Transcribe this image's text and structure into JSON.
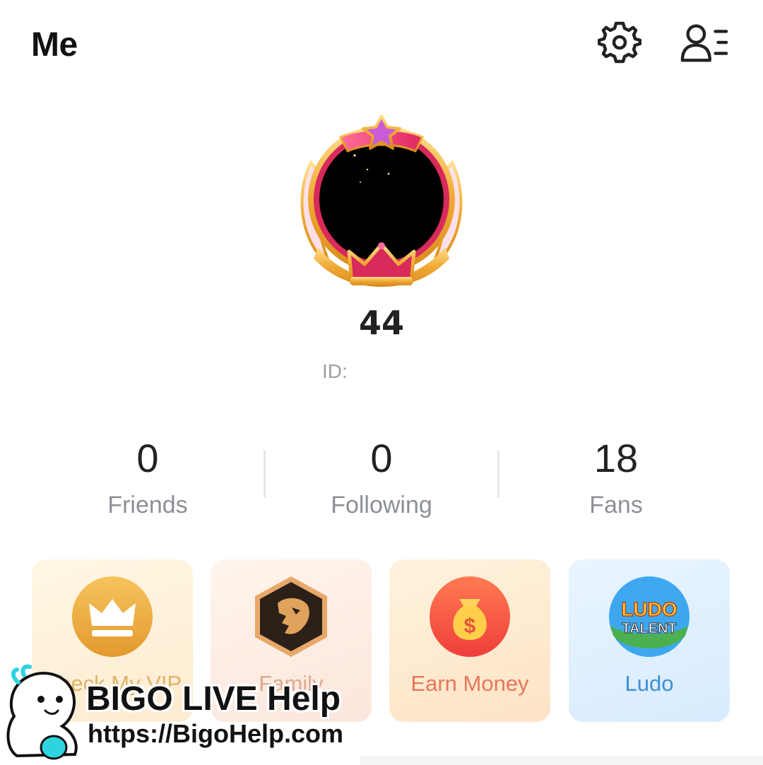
{
  "header": {
    "title": "Me",
    "settings_icon": "gear-icon",
    "profile_list_icon": "person-list-icon"
  },
  "profile": {
    "username": "44",
    "id_label": "ID:",
    "frame_icon": "crown-avatar-frame"
  },
  "stats": [
    {
      "value": "0",
      "label": "Friends"
    },
    {
      "value": "0",
      "label": "Following"
    },
    {
      "value": "18",
      "label": "Fans"
    }
  ],
  "cards": [
    {
      "label": "Check My VIP",
      "icon": "crown-icon",
      "color": "#e0b26b"
    },
    {
      "label": "Family",
      "icon": "lion-icon",
      "color": "#e1a88d"
    },
    {
      "label": "Earn Money",
      "icon": "money-bag-icon",
      "color": "#e8765a"
    },
    {
      "label": "Ludo",
      "icon": "ludo-talent-icon",
      "color": "#3d8fd6",
      "icon_text_1": "LUDO",
      "icon_text_2": "TALENT"
    }
  ],
  "watermark": {
    "title": "BIGO LIVE Help",
    "url": "https://BigoHelp.com"
  },
  "colors": {
    "accent_gold": "#f0a935",
    "stat_label": "#8c9096",
    "id_text": "#9aa0a6"
  }
}
